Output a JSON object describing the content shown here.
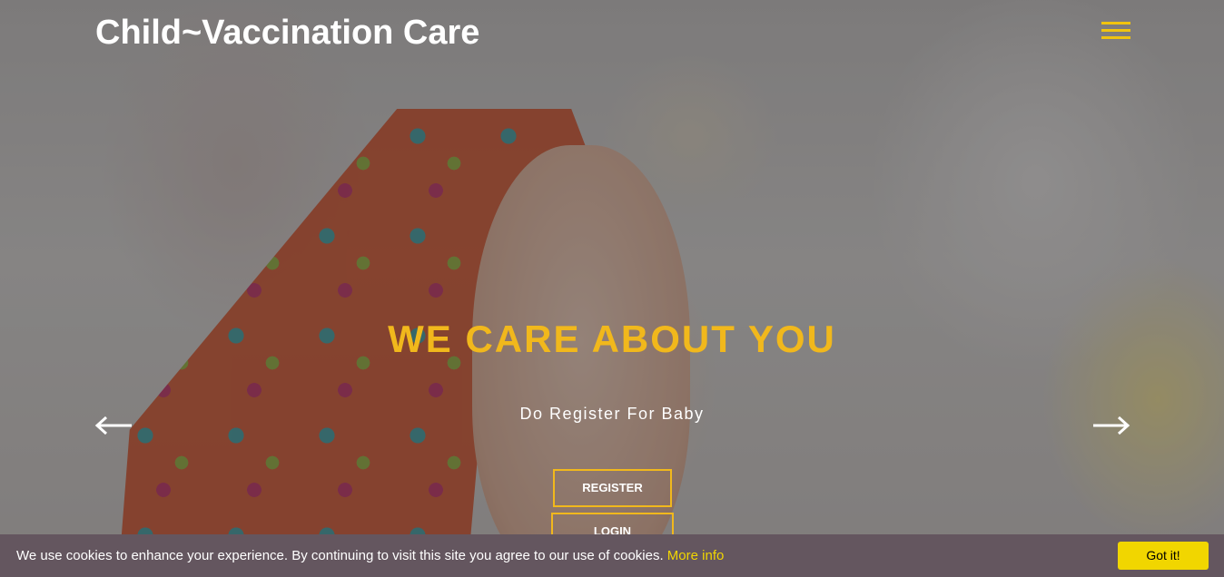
{
  "header": {
    "brand": "Child~Vaccination Care",
    "menu_icon": "hamburger-menu-icon",
    "accent_color": "#f1c40f"
  },
  "hero": {
    "headline": "WE CARE ABOUT YOU",
    "subheadline": "Do Register For Baby",
    "register_label": "REGISTER",
    "login_label": "LOGIN",
    "prev_icon": "arrow-left-icon",
    "next_icon": "arrow-right-icon",
    "headline_color": "#f1b81c"
  },
  "cookie_banner": {
    "message": "We use cookies to enhance your experience. By continuing to visit this site you agree to our use of cookies.",
    "more_info_label": "More info",
    "accept_label": "Got it!",
    "background_color": "#64565f",
    "button_color": "#f1d600"
  }
}
